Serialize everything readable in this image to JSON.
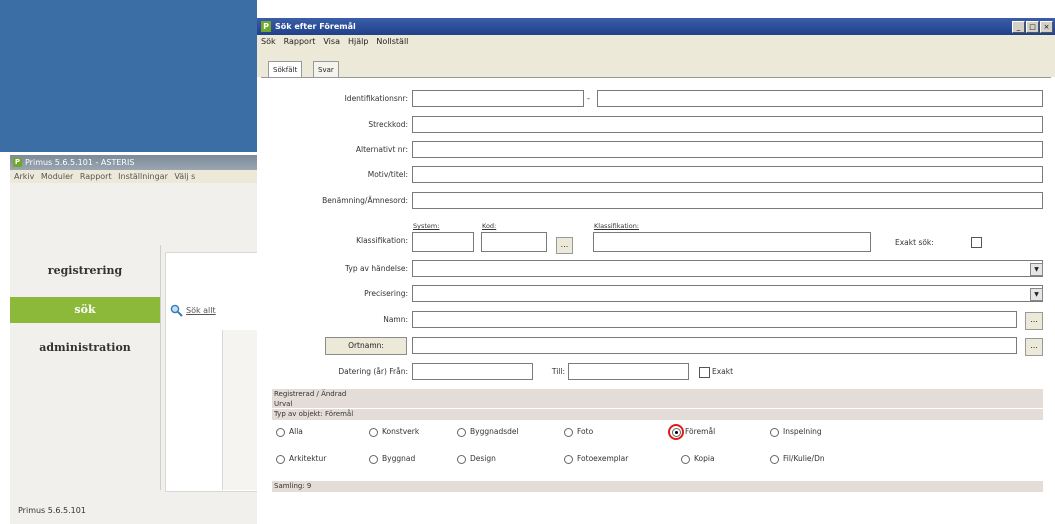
{
  "main_window": {
    "title": "Primus 5.6.5.101 - ASTERIS",
    "menu": [
      "Arkiv",
      "Moduler",
      "Rapport",
      "Inställningar",
      "Välj s"
    ],
    "nav": [
      "registrering",
      "sök",
      "administration"
    ],
    "search_link": "Sök allt",
    "status": "Primus 5.6.5.101"
  },
  "dialog": {
    "title": "Sök efter Föremål",
    "menu": [
      "Sök",
      "Rapport",
      "Visa",
      "Hjälp",
      "Nollställ"
    ],
    "tabs": [
      "Sökfält",
      "Svar"
    ],
    "fields": {
      "identifikationsnr": "Identifikationsnr:",
      "streckkod": "Streckkod:",
      "alternativt_nr": "Alternativt nr:",
      "motivtitel": "Motiv/titel:",
      "benamning": "Benämning/Ämnesord:",
      "klassifikation": "Klassifikation:",
      "system": "System:",
      "kod": "Kod:",
      "klassifikation_sub": "Klassifikation:",
      "exakt_sok": "Exakt sök:",
      "typ_av_handelse": "Typ av händelse:",
      "precisering": "Precisering:",
      "namn": "Namn:",
      "ortnamn_btn": "Ortnamn:",
      "datering_fran": "Datering (år) Från:",
      "till": "Till:",
      "exakt": "Exakt",
      "dash": "-",
      "ellipsis": "..."
    },
    "sections": {
      "registrerad": "Registrerad / Ändrad",
      "urval": "Urval",
      "typ_av_objekt": "Typ av objekt: Föremål",
      "samling": "Samling: 9"
    },
    "radios_row1": [
      "Alla",
      "Konstverk",
      "Byggnadsdel",
      "Foto",
      "Föremål",
      "Inspelning"
    ],
    "radios_row2": [
      "Arkitektur",
      "Byggnad",
      "Design",
      "Fotoexemplar",
      "Kopia",
      "Fil/Kulie/Dn"
    ],
    "selected_radio": "Föremål",
    "window_buttons": [
      "_",
      "□",
      "×"
    ]
  }
}
